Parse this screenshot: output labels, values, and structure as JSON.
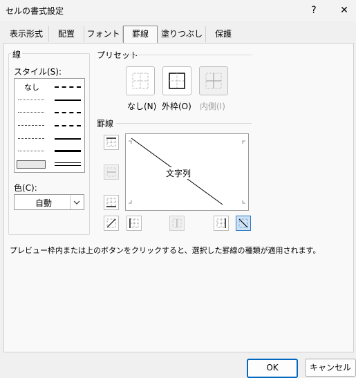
{
  "window": {
    "title": "セルの書式設定",
    "help_glyph": "?",
    "close_glyph": "✕"
  },
  "tabs": [
    {
      "label": "表示形式"
    },
    {
      "label": "配置"
    },
    {
      "label": "フォント"
    },
    {
      "label": "罫線",
      "active": true
    },
    {
      "label": "塗りつぶし"
    },
    {
      "label": "保護"
    }
  ],
  "line": {
    "group_label": "線",
    "style_label": "スタイル(S):",
    "none_label": "なし",
    "color_label": "色(C):",
    "color_value": "自動"
  },
  "presets": {
    "group_label": "プリセット",
    "items": [
      {
        "label": "なし(N)",
        "icon": "preset-none-icon"
      },
      {
        "label": "外枠(O)",
        "icon": "preset-outline-icon"
      },
      {
        "label": "内側(I)",
        "icon": "preset-inside-icon",
        "disabled": true
      }
    ]
  },
  "border": {
    "group_label": "罫線",
    "preview_text": "文字列",
    "buttons": [
      {
        "name": "border-top-button",
        "icon": "border-top-icon"
      },
      {
        "name": "border-inner-horizontal-button",
        "icon": "border-inner-horizontal-icon",
        "disabled": true
      },
      {
        "name": "border-bottom-button",
        "icon": "border-bottom-icon"
      },
      {
        "name": "border-diagonal-up-button",
        "icon": "diagonal-up-icon"
      },
      {
        "name": "border-left-button",
        "icon": "border-left-icon"
      },
      {
        "name": "border-inner-vertical-button",
        "icon": "border-inner-vertical-icon",
        "disabled": true
      },
      {
        "name": "border-right-button",
        "icon": "border-right-icon"
      },
      {
        "name": "border-diagonal-down-button",
        "icon": "diagonal-down-icon",
        "active": true
      }
    ]
  },
  "hint": "プレビュー枠内または上のボタンをクリックすると、選択した罫線の種類が適用されます。",
  "footer": {
    "ok": "OK",
    "cancel": "キャンセル"
  },
  "colors": {
    "accent": "#0067c0",
    "active_fill": "#cfe3f7"
  }
}
